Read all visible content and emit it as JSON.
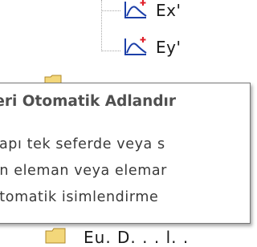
{
  "tree": {
    "items": [
      {
        "label": "Ex'",
        "icon": "curve-plus-icon"
      },
      {
        "label": "Ey'",
        "icon": "curve-plus-icon"
      }
    ],
    "bottom_item_label": "Eu. D. . . l. ."
  },
  "tooltip": {
    "title": "leri Otomatik Adlandır",
    "lines": [
      "yapı tek seferde veya s",
      "en eleman veya elemar",
      "otomatik isimlendirme"
    ]
  },
  "colors": {
    "icon_blue": "#1c3fa8",
    "icon_red": "#e0202a",
    "tooltip_border": "#767676"
  }
}
